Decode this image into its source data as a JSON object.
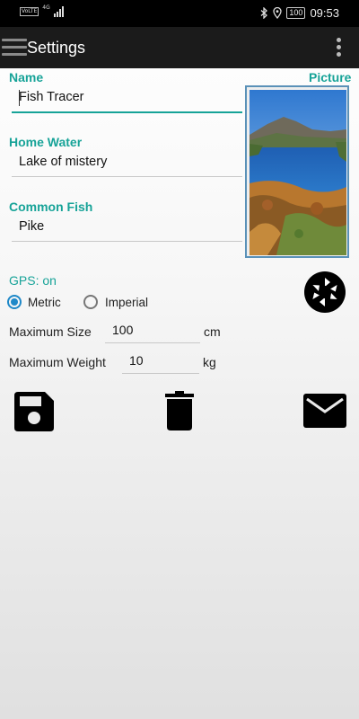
{
  "status_bar": {
    "network_badge": "VoLTE",
    "network_type": "4G",
    "battery": "100",
    "time": "09:53"
  },
  "app_bar": {
    "title": "Settings"
  },
  "form": {
    "name": {
      "label": "Name",
      "value": "Fish Tracer"
    },
    "home_water": {
      "label": "Home Water",
      "value": "Lake of mistery"
    },
    "common_fish": {
      "label": "Common Fish",
      "value": "Pike"
    },
    "picture_label": "Picture"
  },
  "gps": {
    "text": "GPS: on"
  },
  "units": {
    "options": [
      "Metric",
      "Imperial"
    ],
    "selected": "Metric"
  },
  "maximum_size": {
    "label": "Maximum Size",
    "value": "100",
    "unit": "cm"
  },
  "maximum_weight": {
    "label": "Maximum Weight",
    "value": "10",
    "unit": "kg"
  },
  "actions": {
    "icons": [
      "save-icon",
      "delete-icon",
      "mail-icon",
      "camera-shutter-icon"
    ]
  },
  "colors": {
    "accent": "#17a398",
    "radio": "#1e88c8",
    "app_bar": "#1b1b1b",
    "picture_border": "#5a91b8"
  }
}
